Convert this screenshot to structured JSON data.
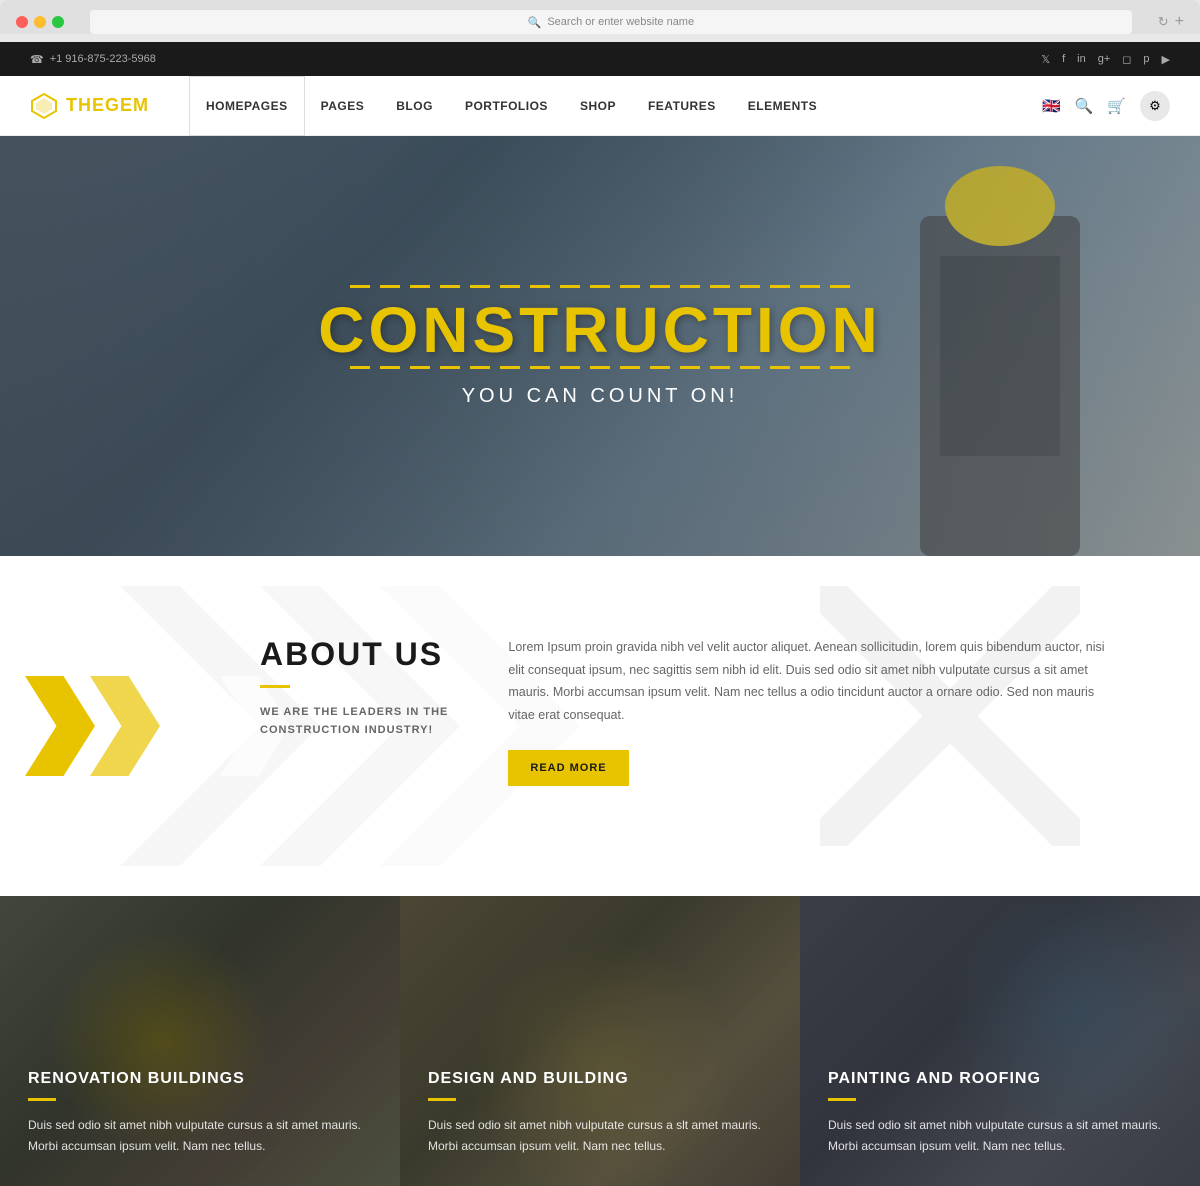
{
  "browser": {
    "address_placeholder": "Search or enter website name"
  },
  "topbar": {
    "phone": "+1 916-875-223-5968",
    "phone_icon": "☎",
    "social_links": [
      "𝕏",
      "f",
      "in",
      "g+",
      "◻",
      "p",
      "▶"
    ]
  },
  "nav": {
    "logo_text_gem": "GEM",
    "logo_text_the": "THE",
    "items": [
      {
        "label": "HOMEPAGES",
        "active": true
      },
      {
        "label": "PAGES",
        "active": false
      },
      {
        "label": "BLOG",
        "active": false
      },
      {
        "label": "PORTFOLIOS",
        "active": false
      },
      {
        "label": "SHOP",
        "active": false
      },
      {
        "label": "FEATURES",
        "active": false
      },
      {
        "label": "ELEMENTS",
        "active": false
      }
    ]
  },
  "hero": {
    "title": "CONSTRUCTION",
    "subtitle": "YOU CAN COUNT ON!"
  },
  "about": {
    "title": "ABOUT US",
    "subtitle": "WE ARE THE LEADERS IN THE\nCONSTRUCTION INDUSTRY!",
    "text": "Lorem Ipsum proin gravida nibh vel velit auctor aliquet. Aenean sollicitudin, lorem quis bibendum auctor, nisi elit consequat ipsum, nec sagittis sem nibh id elit. Duis sed odio sit amet nibh vulputate cursus a sit amet mauris. Morbi accumsan ipsum velit. Nam nec tellus a odio tincidunt auctor a ornare odio. Sed non mauris vitae erat consequat.",
    "read_more": "READ MoRE"
  },
  "services": [
    {
      "title": "RENOVATION BUILDINGS",
      "text": "Duis sed odio sit amet nibh vulputate cursus a sit amet mauris. Morbi accumsan ipsum velit. Nam nec tellus."
    },
    {
      "title": "DESIGN AND BUILDING",
      "text": "Duis sed odio sit amet nibh vulputate cursus a slt amet mauris. Morbi accumsan ipsum velit. Nam nec tellus."
    },
    {
      "title": "PAINTING AND ROOFING",
      "text": "Duis sed odio sit amet nibh vulputate cursus a sit amet mauris. Morbi accumsan ipsum velit. Nam nec tellus."
    }
  ]
}
